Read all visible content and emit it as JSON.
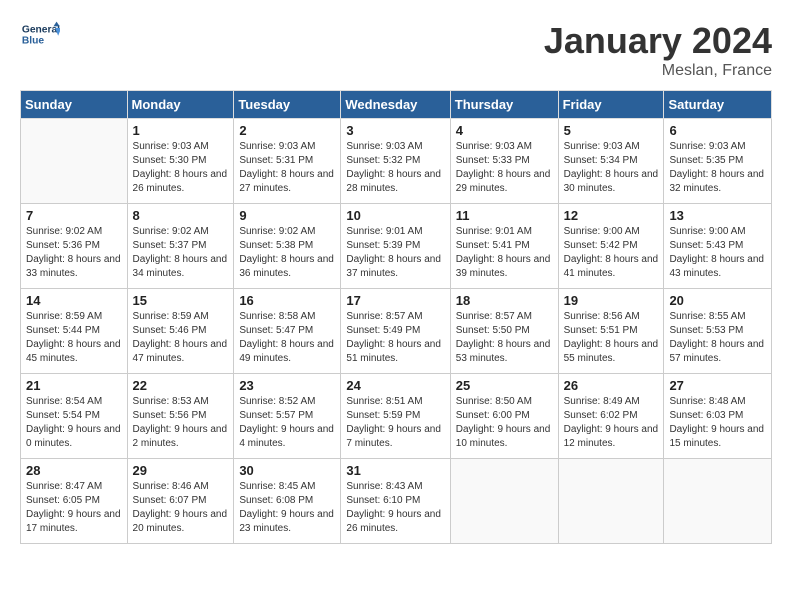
{
  "header": {
    "title": "January 2024",
    "location": "Meslan, France",
    "logo_text_general": "General",
    "logo_text_blue": "Blue"
  },
  "weekdays": [
    "Sunday",
    "Monday",
    "Tuesday",
    "Wednesday",
    "Thursday",
    "Friday",
    "Saturday"
  ],
  "weeks": [
    [
      {
        "day": "",
        "empty": true
      },
      {
        "day": "1",
        "sunrise": "9:03 AM",
        "sunset": "5:30 PM",
        "daylight": "8 hours and 26 minutes."
      },
      {
        "day": "2",
        "sunrise": "9:03 AM",
        "sunset": "5:31 PM",
        "daylight": "8 hours and 27 minutes."
      },
      {
        "day": "3",
        "sunrise": "9:03 AM",
        "sunset": "5:32 PM",
        "daylight": "8 hours and 28 minutes."
      },
      {
        "day": "4",
        "sunrise": "9:03 AM",
        "sunset": "5:33 PM",
        "daylight": "8 hours and 29 minutes."
      },
      {
        "day": "5",
        "sunrise": "9:03 AM",
        "sunset": "5:34 PM",
        "daylight": "8 hours and 30 minutes."
      },
      {
        "day": "6",
        "sunrise": "9:03 AM",
        "sunset": "5:35 PM",
        "daylight": "8 hours and 32 minutes."
      }
    ],
    [
      {
        "day": "7",
        "sunrise": "9:02 AM",
        "sunset": "5:36 PM",
        "daylight": "8 hours and 33 minutes."
      },
      {
        "day": "8",
        "sunrise": "9:02 AM",
        "sunset": "5:37 PM",
        "daylight": "8 hours and 34 minutes."
      },
      {
        "day": "9",
        "sunrise": "9:02 AM",
        "sunset": "5:38 PM",
        "daylight": "8 hours and 36 minutes."
      },
      {
        "day": "10",
        "sunrise": "9:01 AM",
        "sunset": "5:39 PM",
        "daylight": "8 hours and 37 minutes."
      },
      {
        "day": "11",
        "sunrise": "9:01 AM",
        "sunset": "5:41 PM",
        "daylight": "8 hours and 39 minutes."
      },
      {
        "day": "12",
        "sunrise": "9:00 AM",
        "sunset": "5:42 PM",
        "daylight": "8 hours and 41 minutes."
      },
      {
        "day": "13",
        "sunrise": "9:00 AM",
        "sunset": "5:43 PM",
        "daylight": "8 hours and 43 minutes."
      }
    ],
    [
      {
        "day": "14",
        "sunrise": "8:59 AM",
        "sunset": "5:44 PM",
        "daylight": "8 hours and 45 minutes."
      },
      {
        "day": "15",
        "sunrise": "8:59 AM",
        "sunset": "5:46 PM",
        "daylight": "8 hours and 47 minutes."
      },
      {
        "day": "16",
        "sunrise": "8:58 AM",
        "sunset": "5:47 PM",
        "daylight": "8 hours and 49 minutes."
      },
      {
        "day": "17",
        "sunrise": "8:57 AM",
        "sunset": "5:49 PM",
        "daylight": "8 hours and 51 minutes."
      },
      {
        "day": "18",
        "sunrise": "8:57 AM",
        "sunset": "5:50 PM",
        "daylight": "8 hours and 53 minutes."
      },
      {
        "day": "19",
        "sunrise": "8:56 AM",
        "sunset": "5:51 PM",
        "daylight": "8 hours and 55 minutes."
      },
      {
        "day": "20",
        "sunrise": "8:55 AM",
        "sunset": "5:53 PM",
        "daylight": "8 hours and 57 minutes."
      }
    ],
    [
      {
        "day": "21",
        "sunrise": "8:54 AM",
        "sunset": "5:54 PM",
        "daylight": "9 hours and 0 minutes."
      },
      {
        "day": "22",
        "sunrise": "8:53 AM",
        "sunset": "5:56 PM",
        "daylight": "9 hours and 2 minutes."
      },
      {
        "day": "23",
        "sunrise": "8:52 AM",
        "sunset": "5:57 PM",
        "daylight": "9 hours and 4 minutes."
      },
      {
        "day": "24",
        "sunrise": "8:51 AM",
        "sunset": "5:59 PM",
        "daylight": "9 hours and 7 minutes."
      },
      {
        "day": "25",
        "sunrise": "8:50 AM",
        "sunset": "6:00 PM",
        "daylight": "9 hours and 10 minutes."
      },
      {
        "day": "26",
        "sunrise": "8:49 AM",
        "sunset": "6:02 PM",
        "daylight": "9 hours and 12 minutes."
      },
      {
        "day": "27",
        "sunrise": "8:48 AM",
        "sunset": "6:03 PM",
        "daylight": "9 hours and 15 minutes."
      }
    ],
    [
      {
        "day": "28",
        "sunrise": "8:47 AM",
        "sunset": "6:05 PM",
        "daylight": "9 hours and 17 minutes."
      },
      {
        "day": "29",
        "sunrise": "8:46 AM",
        "sunset": "6:07 PM",
        "daylight": "9 hours and 20 minutes."
      },
      {
        "day": "30",
        "sunrise": "8:45 AM",
        "sunset": "6:08 PM",
        "daylight": "9 hours and 23 minutes."
      },
      {
        "day": "31",
        "sunrise": "8:43 AM",
        "sunset": "6:10 PM",
        "daylight": "9 hours and 26 minutes."
      },
      {
        "day": "",
        "empty": true
      },
      {
        "day": "",
        "empty": true
      },
      {
        "day": "",
        "empty": true
      }
    ]
  ],
  "labels": {
    "sunrise": "Sunrise:",
    "sunset": "Sunset:",
    "daylight": "Daylight:"
  }
}
